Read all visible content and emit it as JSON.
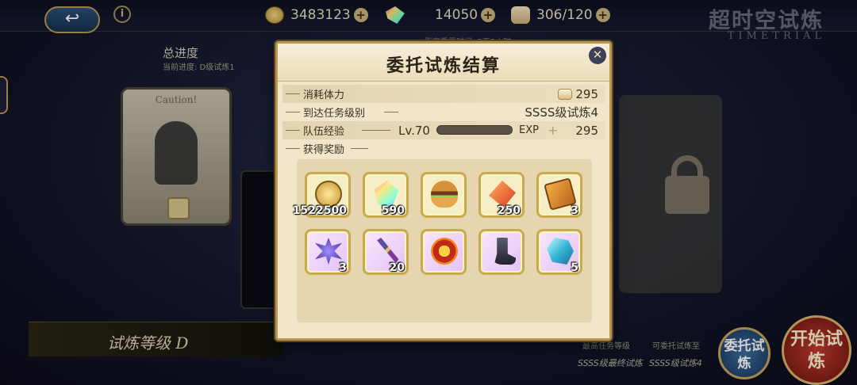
{
  "topbar": {
    "back_icon": "↩",
    "info_icon": "i",
    "coins": "3483123",
    "gems": "14050",
    "stamina": "306/120",
    "plus": "+",
    "title": "超时空试炼",
    "subtitle": "TIMETRIAL"
  },
  "page": {
    "progress_label": "总进度",
    "current_progress": "当前进度: D级试炼1",
    "refresh_text": "距离重置时间: 3天2小时",
    "caution_title": "Caution!",
    "rank_label": "试炼等级 D",
    "highest_label": "最高任务等级",
    "delegable_label": "可委托试炼至",
    "highest_value": "SSSS级最终试炼",
    "delegable_value": "SSSS级试炼4",
    "delegate_button": "委托试炼",
    "start_button": "开始试炼"
  },
  "modal": {
    "title": "委托试炼结算",
    "close_icon": "✕",
    "stamina_label": "消耗体力",
    "stamina_value": "295",
    "reached_label": "到达任务级别",
    "reached_value": "SSSS级试炼4",
    "team_exp_label": "队伍经验",
    "level": "Lv.70",
    "exp_label": "EXP",
    "exp_plus": "+",
    "exp_value": "295",
    "rewards_label": "获得奖励",
    "exp_fill": 1.0,
    "rewards": [
      {
        "name": "gold-coin",
        "qty": "1522500"
      },
      {
        "name": "rainbow-gem",
        "qty": "590"
      },
      {
        "name": "burger",
        "qty": ""
      },
      {
        "name": "fire-leaf",
        "qty": "250"
      },
      {
        "name": "ticket",
        "qty": "3"
      },
      {
        "name": "spiky-crystal",
        "qty": "3"
      },
      {
        "name": "staff",
        "qty": "20"
      },
      {
        "name": "sun-emblem",
        "qty": ""
      },
      {
        "name": "dark-boot",
        "qty": ""
      },
      {
        "name": "ice-crystal",
        "qty": "5"
      }
    ]
  }
}
